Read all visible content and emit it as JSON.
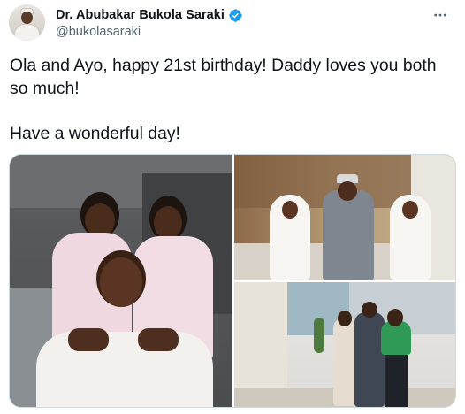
{
  "author": {
    "display_name": "Dr. Abubakar Bukola Saraki",
    "handle": "@bukolasaraki",
    "verified": true,
    "avatar_icon": "profile-photo",
    "verified_icon": "verified-badge-icon",
    "verified_color": "#1d9bf0"
  },
  "menu": {
    "icon": "more-options-icon"
  },
  "tweet": {
    "line1": "Ola and Ayo, happy 21st birthday! Daddy loves you both so much!",
    "line2": "Have a wonderful day!"
  },
  "media": {
    "photo_count": 3
  },
  "colors": {
    "text": "#0f1419",
    "secondary_text": "#536471",
    "border": "#cfd9de"
  }
}
